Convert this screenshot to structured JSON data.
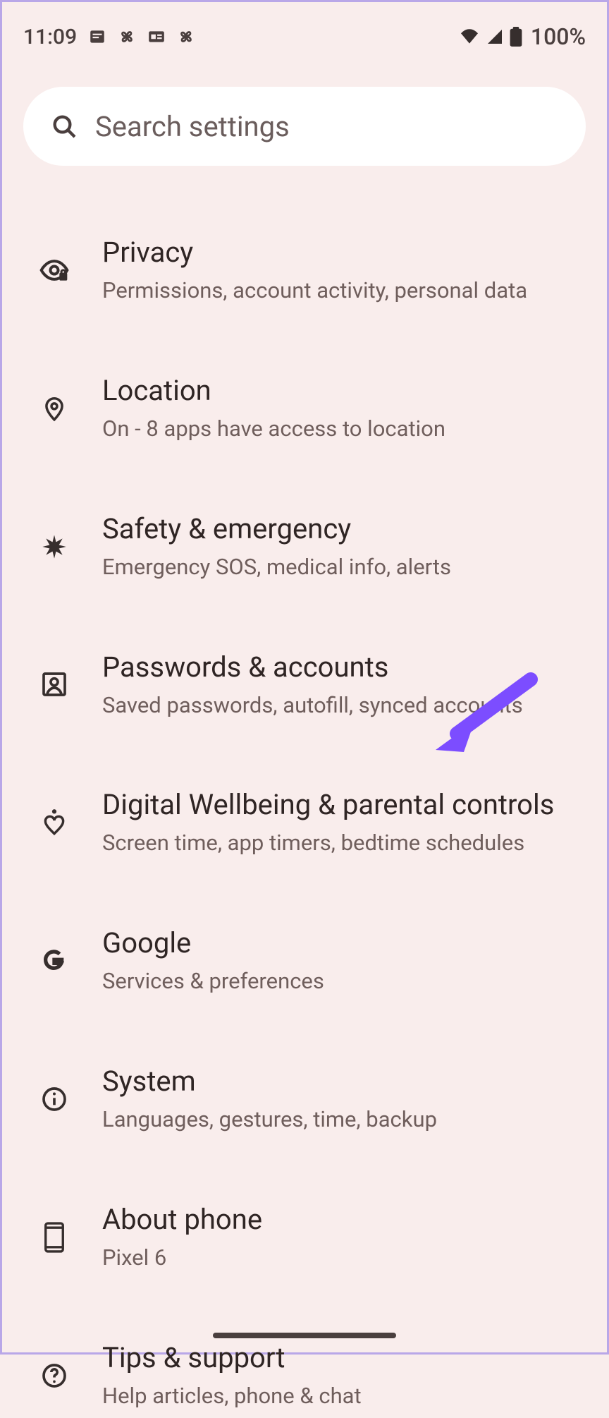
{
  "status": {
    "time": "11:09",
    "battery": "100%"
  },
  "search": {
    "placeholder": "Search settings"
  },
  "items": [
    {
      "title": "Privacy",
      "subtitle": "Permissions, account activity, personal data"
    },
    {
      "title": "Location",
      "subtitle": "On - 8 apps have access to location"
    },
    {
      "title": "Safety & emergency",
      "subtitle": "Emergency SOS, medical info, alerts"
    },
    {
      "title": "Passwords & accounts",
      "subtitle": "Saved passwords, autofill, synced accounts"
    },
    {
      "title": "Digital Wellbeing & parental controls",
      "subtitle": "Screen time, app timers, bedtime schedules"
    },
    {
      "title": "Google",
      "subtitle": "Services & preferences"
    },
    {
      "title": "System",
      "subtitle": "Languages, gestures, time, backup"
    },
    {
      "title": "About phone",
      "subtitle": "Pixel 6"
    },
    {
      "title": "Tips & support",
      "subtitle": "Help articles, phone & chat"
    }
  ]
}
